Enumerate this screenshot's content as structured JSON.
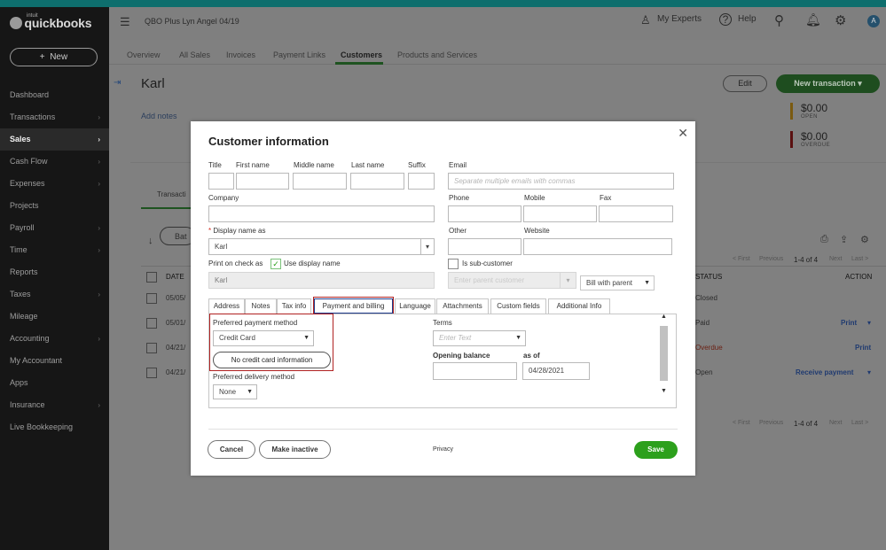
{
  "app": {
    "brand_small": "intuit",
    "brand": "quickbooks",
    "new_label": "New",
    "company": "QBO Plus Lyn Angel 04/19"
  },
  "sidebar": {
    "items": [
      {
        "label": "Dashboard",
        "chev": ""
      },
      {
        "label": "Transactions",
        "chev": "›"
      },
      {
        "label": "Sales",
        "chev": "›",
        "active": true
      },
      {
        "label": "Cash Flow",
        "chev": "›"
      },
      {
        "label": "Expenses",
        "chev": "›"
      },
      {
        "label": "Projects",
        "chev": ""
      },
      {
        "label": "Payroll",
        "chev": "›"
      },
      {
        "label": "Time",
        "chev": "›"
      },
      {
        "label": "Reports",
        "chev": ""
      },
      {
        "label": "Taxes",
        "chev": "›"
      },
      {
        "label": "Mileage",
        "chev": ""
      },
      {
        "label": "Accounting",
        "chev": "›"
      },
      {
        "label": "My Accountant",
        "chev": ""
      },
      {
        "label": "Apps",
        "chev": ""
      },
      {
        "label": "Insurance",
        "chev": "›"
      },
      {
        "label": "Live Bookkeeping",
        "chev": ""
      }
    ]
  },
  "header": {
    "my_experts": "My Experts",
    "help": "Help",
    "avatar": "A",
    "icons": {
      "experts": "person-icon",
      "help": "question-icon",
      "search": "search-icon",
      "bell": "bell-icon",
      "gear": "gear-icon"
    }
  },
  "tabs": [
    "Overview",
    "All Sales",
    "Invoices",
    "Payment Links",
    "Customers",
    "Products and Services"
  ],
  "customer": {
    "name": "Karl",
    "add_notes": "Add notes",
    "edit": "Edit",
    "new_transaction": "New transaction",
    "open_amount": "$0.00",
    "open_label": "OPEN",
    "overdue_amount": "$0.00",
    "overdue_label": "OVERDUE"
  },
  "background": {
    "transactions_tab": "Transacti",
    "batch": "Bat",
    "date_col": "DATE",
    "status_col": "STATUS",
    "action_col": "ACTION",
    "pagination": {
      "first": "< First",
      "previous": "Previous",
      "range": "1-4 of 4",
      "next": "Next",
      "last": "Last >"
    },
    "rows": [
      {
        "date": "05/05/",
        "status": "Closed",
        "action": ""
      },
      {
        "date": "05/01/",
        "status": "Paid",
        "action": "Print"
      },
      {
        "date": "04/21/",
        "status": "Overdue",
        "action": "Print"
      },
      {
        "date": "04/21/",
        "status": "Open",
        "action": "Receive payment"
      }
    ]
  },
  "dialog": {
    "title": "Customer information",
    "labels": {
      "title": "Title",
      "first": "First name",
      "middle": "Middle name",
      "last": "Last name",
      "suffix": "Suffix",
      "email": "Email",
      "company": "Company",
      "phone": "Phone",
      "mobile": "Mobile",
      "fax": "Fax",
      "display": "Display name as",
      "other": "Other",
      "website": "Website",
      "print_on_check": "Print on check as",
      "use_display": "Use display name",
      "sub_customer": "Is sub-customer"
    },
    "required_mark": "*",
    "email_placeholder": "Separate multiple emails with commas",
    "display_value": "Karl",
    "print_value": "Karl",
    "parent_placeholder": "Enter parent customer",
    "bill_with_parent": "Bill with parent",
    "tabs": [
      "Address",
      "Notes",
      "Tax info",
      "Payment and billing",
      "Language",
      "Attachments",
      "Custom fields",
      "Additional Info"
    ],
    "payment": {
      "preferred_payment_label": "Preferred payment method",
      "preferred_payment_value": "Credit Card",
      "no_credit_card": "No credit card information",
      "preferred_delivery_label": "Preferred delivery method",
      "preferred_delivery_value": "None",
      "terms_label": "Terms",
      "terms_placeholder": "Enter Text",
      "opening_balance_label": "Opening balance",
      "as_of_label": "as of",
      "as_of_value": "04/28/2021"
    },
    "footer": {
      "cancel": "Cancel",
      "make_inactive": "Make inactive",
      "privacy": "Privacy",
      "save": "Save"
    }
  },
  "colors": {
    "overlay": "#808080",
    "sidebar": "#161616",
    "brand_green": "#2ca01c",
    "highlight_red": "#b02121",
    "open_bar": "#b8860b",
    "overdue_bar": "#8b1a1a"
  }
}
